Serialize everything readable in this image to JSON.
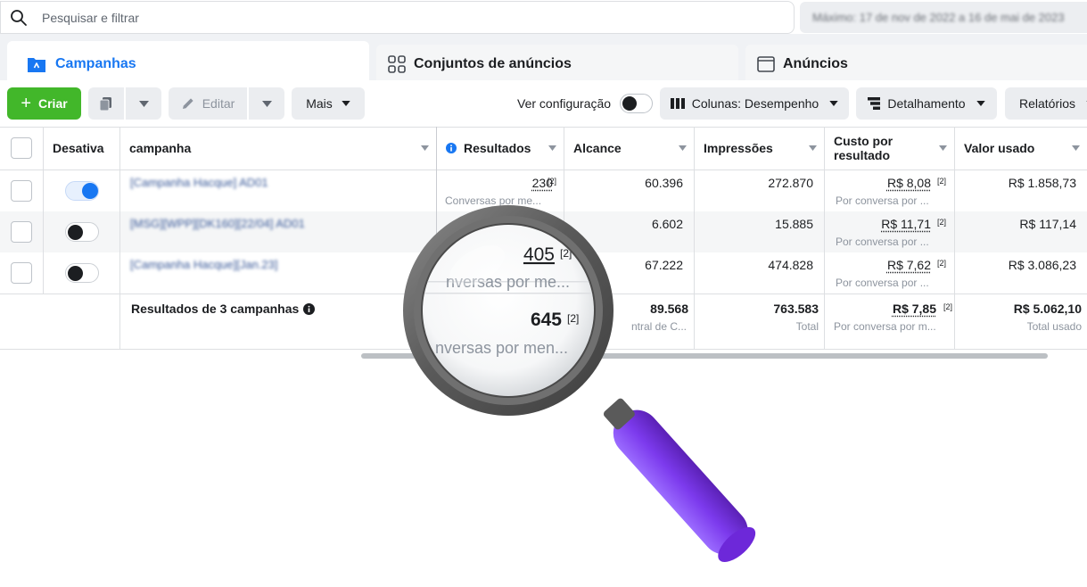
{
  "search": {
    "placeholder": "Pesquisar e filtrar"
  },
  "date_range": "Máximo: 17 de nov de 2022 a 16 de mai de 2023",
  "tabs": [
    {
      "label": "Campanhas",
      "active": true
    },
    {
      "label": "Conjuntos de anúncios",
      "active": false
    },
    {
      "label": "Anúncios",
      "active": false
    }
  ],
  "toolbar": {
    "criar": "Criar",
    "editar": "Editar",
    "mais": "Mais",
    "ver_configuracao": "Ver configuração",
    "colunas": "Colunas: Desempenho",
    "detalhamento": "Detalhamento",
    "relatorios": "Relatórios"
  },
  "columns": {
    "desativar": "Desativa",
    "campanha": "campanha",
    "resultados": "Resultados",
    "alcance": "Alcance",
    "impressoes": "Impressões",
    "custo_line1": "Custo por",
    "custo_line2": "resultado",
    "valor_usado": "Valor usado"
  },
  "rows": [
    {
      "name": "[Campanha Hacque] AD01",
      "on": true,
      "resultados": "230",
      "resultados_note": "[2]",
      "resultados_sub": "Conversas por me...",
      "alcance": "60.396",
      "impressoes": "272.870",
      "custo": "R$ 8,08",
      "custo_note": "[2]",
      "custo_sub": "Por conversa por ...",
      "valor": "R$ 1.858,73"
    },
    {
      "name": "[MSG][WPP][DK160][22/04] AD01",
      "on": false,
      "alcance": "6.602",
      "impressoes": "15.885",
      "custo": "R$ 11,71",
      "custo_note": "[2]",
      "custo_sub": "Por conversa por ...",
      "valor": "R$ 117,14"
    },
    {
      "name": "[Campanha Hacque][Jan.23]",
      "on": false,
      "resultados": "405",
      "resultados_note": "[2]",
      "resultados_sub": "nversas por me...",
      "alcance": "67.222",
      "impressoes": "474.828",
      "custo": "R$ 7,62",
      "custo_note": "[2]",
      "custo_sub": "Por conversa por ...",
      "valor": "R$ 3.086,23"
    }
  ],
  "totals": {
    "label": "Resultados de 3 campanhas",
    "resultados": "645",
    "resultados_note": "[2]",
    "resultados_sub": "nversas por men...",
    "alcance": "89.568",
    "alcance_sub": "ntral de C...",
    "impressoes": "763.583",
    "impressoes_sub": "Total",
    "custo": "R$ 7,85",
    "custo_note": "[2]",
    "custo_sub": "Por conversa por m...",
    "valor": "R$ 5.062,10",
    "valor_sub": "Total usado"
  },
  "colors": {
    "brand_blue": "#1877f2",
    "create_green": "#42b72a",
    "magnifier_handle": "#7c3aed",
    "magnifier_frame": "#5f5f5f"
  }
}
